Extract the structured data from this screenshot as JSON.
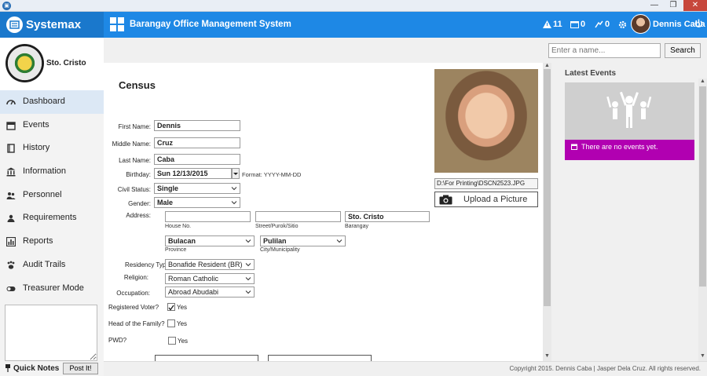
{
  "window": {
    "minimize": "—",
    "restore": "❐",
    "close": "✕"
  },
  "header": {
    "brand": "Systemax",
    "system_title": "Barangay Office Management System",
    "alerts_count": "11",
    "calendar_count": "0",
    "tasks_count": "0",
    "user_name": "Dennis Caba"
  },
  "sidebar": {
    "barangay_name": "Sto. Cristo",
    "items": [
      {
        "label": "Dashboard",
        "icon": "dashboard-icon"
      },
      {
        "label": "Events",
        "icon": "calendar-icon"
      },
      {
        "label": "History",
        "icon": "book-icon"
      },
      {
        "label": "Information",
        "icon": "institution-icon"
      },
      {
        "label": "Personnel",
        "icon": "users-icon"
      },
      {
        "label": "Requirements",
        "icon": "list-icon"
      },
      {
        "label": "Reports",
        "icon": "bar-chart-icon"
      },
      {
        "label": "Audit Trails",
        "icon": "paw-icon"
      },
      {
        "label": "Treasurer Mode",
        "icon": "toggle-icon"
      }
    ],
    "quick_notes_label": "Quick Notes",
    "post_button": "Post It!"
  },
  "search": {
    "placeholder": "Enter a name...",
    "button": "Search"
  },
  "census": {
    "title": "Census",
    "first_name_label": "First Name:",
    "first_name": "Dennis",
    "middle_name_label": "Middle Name:",
    "middle_name": "Cruz",
    "last_name_label": "Last Name:",
    "last_name": "Caba",
    "birthday_label": "Birthday:",
    "birthday": "Sun 12/13/2015",
    "birthday_format": "Format: YYYY-MM-DD",
    "civil_status_label": "Civil Status:",
    "civil_status": "Single",
    "gender_label": "Gender:",
    "gender": "Male",
    "address_label": "Address:",
    "house_no_caption": "House No.",
    "street_caption": "Street/Purok/Sitio",
    "barangay_caption": "Barangay",
    "barangay_value": "Sto. Cristo",
    "province": "Bulacan",
    "province_caption": "Province",
    "city": "Pulilan",
    "city_caption": "City/Municipality",
    "residency_label": "Residency Type:",
    "residency": "Bonafide Resident (BR)",
    "religion_label": "Religion:",
    "religion": "Roman Catholic",
    "occupation_label": "Occupation:",
    "occupation": "Abroad Abudabi",
    "registered_voter_label": "Registered Voter?",
    "head_of_family_label": "Head of the Family?",
    "pwd_label": "PWD?",
    "yes_label": "Yes",
    "photo_path": "D:\\For Printing\\DSCN2523.JPG",
    "upload_button": "Upload a Picture"
  },
  "events": {
    "title": "Latest Events",
    "empty_message": "There are no events yet."
  },
  "footer": {
    "copyright": "Copyright 2015. Dennis Caba | Jasper Dela Cruz. All rights reserved."
  },
  "colors": {
    "header": "#1e88e5",
    "brand": "#1a78cc",
    "events_bar": "#b100b1"
  }
}
